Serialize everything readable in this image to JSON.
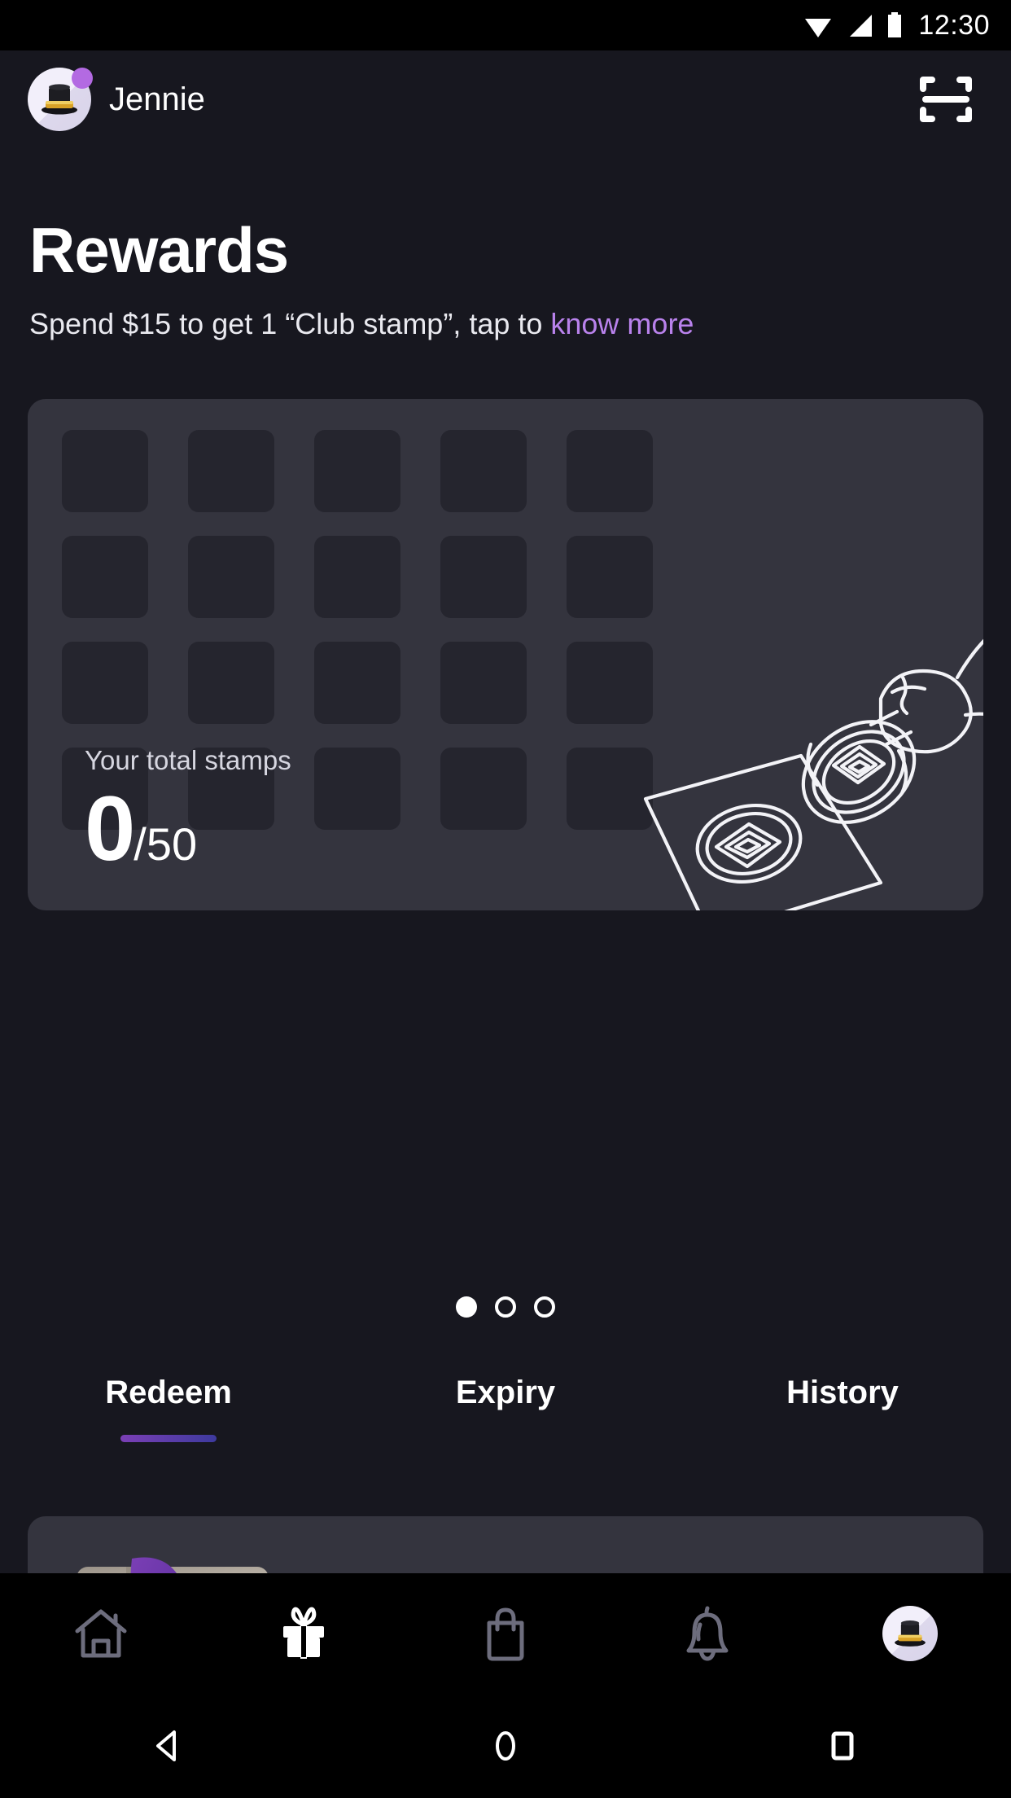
{
  "statusbar": {
    "time": "12:30",
    "icons": [
      "wifi-icon",
      "cellular-signal-icon",
      "battery-icon"
    ]
  },
  "header": {
    "username": "Jennie",
    "avatar_icon": "top-hat-avatar",
    "badge_icon": "notification-dot",
    "scan_icon": "barcode-scan-icon"
  },
  "page": {
    "title": "Rewards",
    "subtitle_prefix": "Spend $15 to get 1 “Club stamp”, tap to ",
    "subtitle_link": "know more"
  },
  "stamp_card": {
    "slots_total": 20,
    "totals_label": "Your total stamps",
    "count": "0",
    "max": "/50",
    "illustration": "rubber-stamp-illustration"
  },
  "carousel": {
    "dots": [
      {
        "state": "active"
      },
      {
        "state": "inactive"
      },
      {
        "state": "inactive"
      }
    ]
  },
  "tabs": [
    {
      "label": "Redeem",
      "active": true
    },
    {
      "label": "Expiry",
      "active": false
    },
    {
      "label": "History",
      "active": false
    }
  ],
  "reward_card": {
    "thumbnail": "reward-photo-thumbnail",
    "ribbon": "purple-ribbon-badge"
  },
  "bottomnav": [
    {
      "name": "home-icon",
      "active": false
    },
    {
      "name": "gift-icon",
      "active": true
    },
    {
      "name": "shopping-bag-icon",
      "active": false
    },
    {
      "name": "bell-icon",
      "active": false
    },
    {
      "name": "profile-avatar",
      "active": false
    }
  ],
  "androidnav": [
    {
      "name": "back-button"
    },
    {
      "name": "home-button"
    },
    {
      "name": "recents-button"
    }
  ],
  "colors": {
    "page_background": "#17171f",
    "card_background": "#34343e",
    "slot_background": "#25252e",
    "accent_purple": "#b982ec",
    "tab_gradient_start": "#7b3fb5",
    "tab_gradient_end": "#3d3a9e",
    "badge_purple": "#b36ae2"
  }
}
